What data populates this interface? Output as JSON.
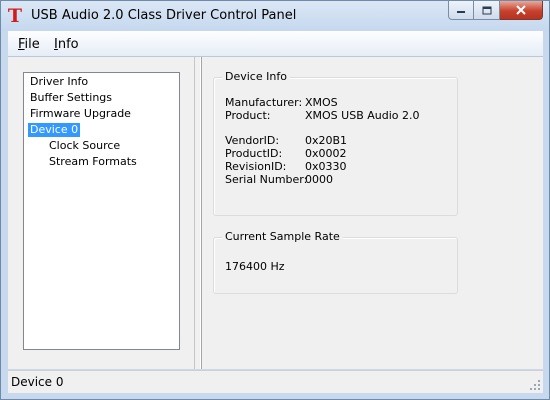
{
  "window": {
    "title": "USB Audio 2.0 Class Driver Control Panel",
    "app_icon_glyph": "T"
  },
  "menu": [
    {
      "accel": "F",
      "rest": "ile"
    },
    {
      "accel": "I",
      "rest": "nfo"
    }
  ],
  "tree": {
    "items": [
      {
        "label": "Driver Info",
        "level": 0,
        "selected": false
      },
      {
        "label": "Buffer Settings",
        "level": 0,
        "selected": false
      },
      {
        "label": "Firmware Upgrade",
        "level": 0,
        "selected": false
      },
      {
        "label": "Device 0",
        "level": 0,
        "selected": true
      },
      {
        "label": "Clock Source",
        "level": 1,
        "selected": false
      },
      {
        "label": "Stream Formats",
        "level": 1,
        "selected": false
      }
    ]
  },
  "device_info": {
    "heading": "Device Info",
    "manufacturer_label": "Manufacturer:",
    "manufacturer_value": "XMOS",
    "product_label": "Product:",
    "product_value": "XMOS USB Audio 2.0",
    "vendor_label": "VendorID:",
    "vendor_value": "0x20B1",
    "productid_label": "ProductID:",
    "productid_value": "0x0002",
    "revision_label": "RevisionID:",
    "revision_value": "0x0330",
    "serial_label": "Serial Number:",
    "serial_value": "0000"
  },
  "sample_rate": {
    "heading": "Current Sample Rate",
    "value": "176400 Hz"
  },
  "status_bar": {
    "text": "Device 0"
  },
  "colors": {
    "selection": "#3399ff",
    "close_button": "#c7422d",
    "app_icon": "#d21c1c"
  }
}
